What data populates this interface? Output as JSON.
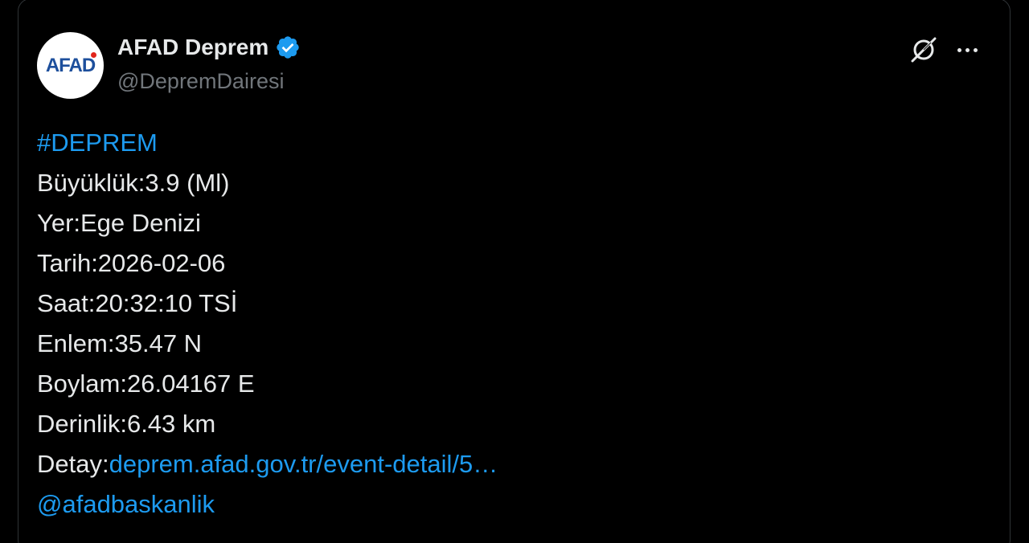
{
  "author": {
    "avatar_text": "AFAD",
    "display_name": "AFAD Deprem",
    "handle": "@DepremDairesi",
    "verified": true
  },
  "icons": {
    "grok": "grok-icon",
    "more": "more-options-icon",
    "verified": "verified-badge-icon"
  },
  "colors": {
    "background": "#000000",
    "text": "#e7e9ea",
    "secondary": "#71767b",
    "link": "#1d9bf0"
  },
  "tweet": {
    "hashtag": "#DEPREM",
    "magnitude": "Büyüklük:3.9 (Ml)",
    "location": "Yer:Ege Denizi",
    "date": "Tarih:2026-02-06",
    "time": "Saat:20:32:10 TSİ",
    "latitude": "Enlem:35.47 N",
    "longitude": "Boylam:26.04167 E",
    "depth": "Derinlik:6.43 km",
    "detail_label": "Detay:",
    "detail_link": "deprem.afad.gov.tr/event-detail/5…",
    "mention": "@afadbaskanlik"
  }
}
